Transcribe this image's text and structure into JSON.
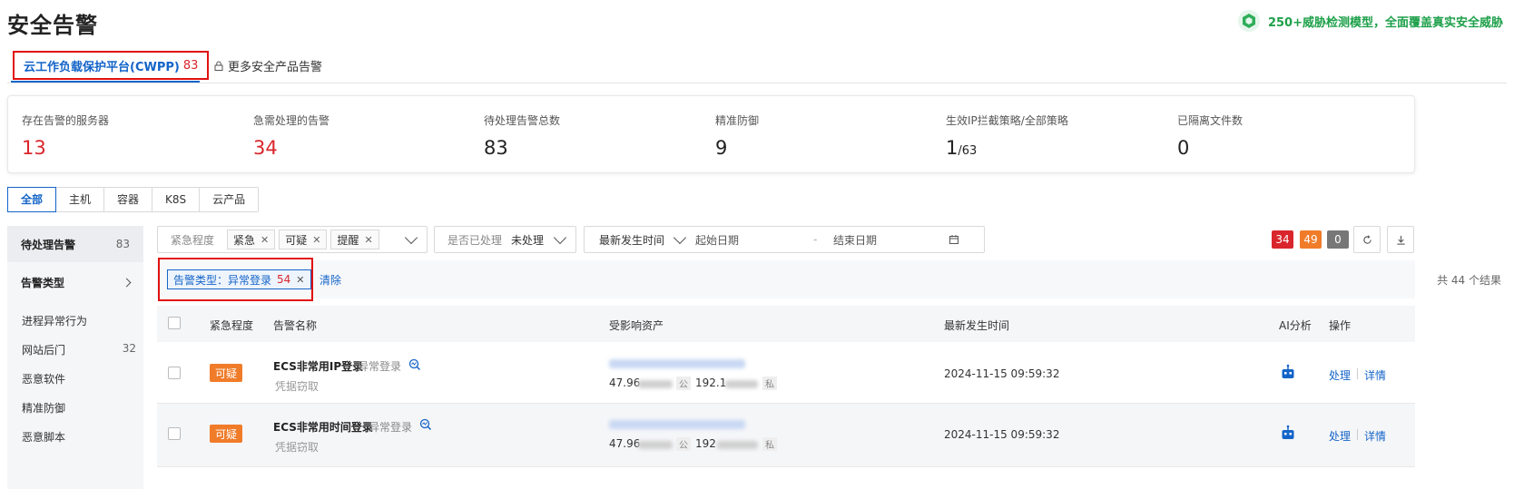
{
  "page": {
    "title": "安全告警"
  },
  "promo": {
    "text": "250+威胁检测模型，全面覆盖真实安全威胁",
    "icon": "shield-hex-icon"
  },
  "tabs": {
    "cwpp": {
      "label": "云工作负载保护平台(CWPP)",
      "count": "83"
    },
    "more": {
      "label": "更多安全产品告警",
      "icon": "lock-icon"
    }
  },
  "stats": [
    {
      "label": "存在告警的服务器",
      "value": "13",
      "color": "#d9262c"
    },
    {
      "label": "急需处理的告警",
      "value": "34",
      "color": "#d9262c"
    },
    {
      "label": "待处理告警总数",
      "value": "83"
    },
    {
      "label": "精准防御",
      "value": "9"
    },
    {
      "label": "生效IP拦截策略/全部策略",
      "value": "1",
      "value_suffix": "/63"
    },
    {
      "label": "已隔离文件数",
      "value": "0"
    }
  ],
  "segments": [
    "全部",
    "主机",
    "容器",
    "K8S",
    "云产品"
  ],
  "sidebar": {
    "pending": {
      "label": "待处理告警",
      "count": "83"
    },
    "types": {
      "label": "告警类型"
    },
    "items": [
      {
        "label": "进程异常行为",
        "count": ""
      },
      {
        "label": "网站后门",
        "count": "32"
      },
      {
        "label": "恶意软件",
        "count": ""
      },
      {
        "label": "精准防御",
        "count": ""
      },
      {
        "label": "恶意脚本",
        "count": ""
      }
    ]
  },
  "filters": {
    "severity": {
      "label": "紧急程度",
      "chips": [
        "紧急",
        "可疑",
        "提醒"
      ]
    },
    "handled": {
      "label": "是否已处理",
      "value": "未处理"
    },
    "time": {
      "label": "最新发生时间",
      "start_placeholder": "起始日期",
      "dash": "-",
      "end_placeholder": "结束日期"
    }
  },
  "badges": [
    {
      "value": "34",
      "color": "#d9262c"
    },
    {
      "value": "49",
      "color": "#f07c2a"
    },
    {
      "value": "0",
      "color": "#777777"
    }
  ],
  "active_filter": {
    "label": "告警类型：异常登录",
    "count": "54",
    "clear": "清除",
    "total": "共 44 个结果"
  },
  "table": {
    "headers": {
      "severity": "紧急程度",
      "name": "告警名称",
      "asset": "受影响资产",
      "time": "最新发生时间",
      "ai": "AI分析",
      "ops": "操作"
    },
    "rows": [
      {
        "severity": "可疑",
        "name": "ECS非常用IP登录",
        "type": "异常登录",
        "sub": "凭据窃取",
        "ip1": "47.96",
        "ip1_tag": "公",
        "ip2": "192.1",
        "ip2_tag": "私",
        "time": "2024-11-15 09:59:32",
        "action1": "处理",
        "action2": "详情"
      },
      {
        "severity": "可疑",
        "name": "ECS非常用时间登录",
        "type": "异常登录",
        "sub": "凭据窃取",
        "ip1": "47.96",
        "ip1_tag": "公",
        "ip2": "192",
        "ip2_tag": "私",
        "time": "2024-11-15 09:59:32",
        "action1": "处理",
        "action2": "详情"
      }
    ]
  }
}
